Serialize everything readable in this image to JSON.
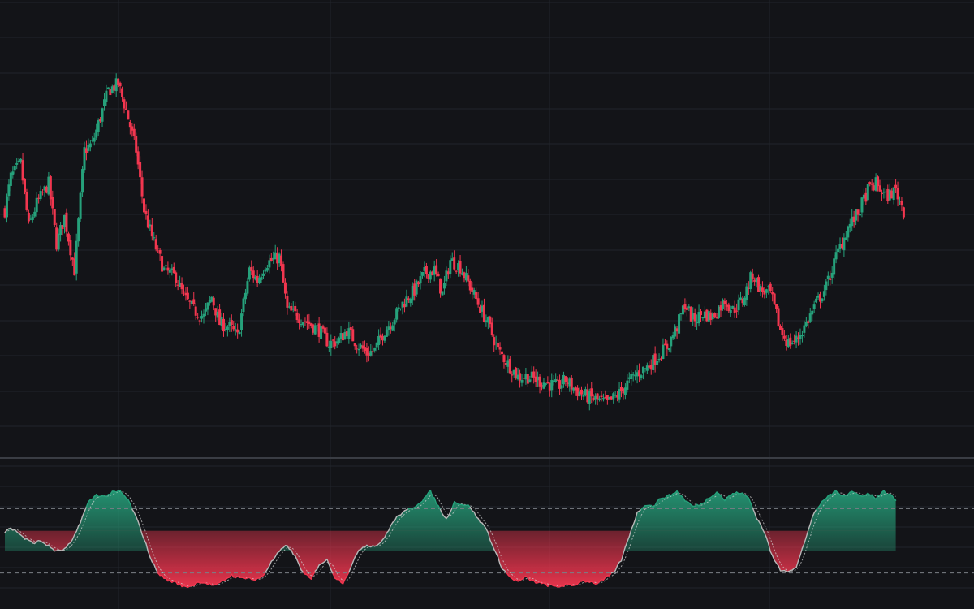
{
  "theme": {
    "background": "#131418",
    "grid_color": "#22252b",
    "separator_color": "#3a3d44",
    "up_color": "#26a17b",
    "down_color": "#f2364f",
    "oscillator_line_color": "#b7b7b7",
    "level_line_color": "#7c7f86"
  },
  "chart_data": [
    {
      "type": "candlestick",
      "pane": "price",
      "grid": true,
      "ylim": [
        0,
        100
      ],
      "anchors_close": [
        [
          0,
          60
        ],
        [
          3,
          70
        ],
        [
          8,
          74
        ],
        [
          12,
          55
        ],
        [
          16,
          62
        ],
        [
          22,
          68
        ],
        [
          26,
          50
        ],
        [
          30,
          58
        ],
        [
          35,
          42
        ],
        [
          40,
          78
        ],
        [
          44,
          80
        ],
        [
          48,
          88
        ],
        [
          52,
          96
        ],
        [
          57,
          98
        ],
        [
          61,
          90
        ],
        [
          66,
          78
        ],
        [
          70,
          60
        ],
        [
          74,
          52
        ],
        [
          80,
          42
        ],
        [
          86,
          40
        ],
        [
          90,
          34
        ],
        [
          95,
          30
        ],
        [
          100,
          28
        ],
        [
          104,
          34
        ],
        [
          108,
          26
        ],
        [
          113,
          25
        ],
        [
          117,
          22
        ],
        [
          123,
          42
        ],
        [
          127,
          39
        ],
        [
          131,
          44
        ],
        [
          138,
          46
        ],
        [
          142,
          30
        ],
        [
          148,
          28
        ],
        [
          153,
          26
        ],
        [
          158,
          24
        ],
        [
          163,
          20
        ],
        [
          168,
          21
        ],
        [
          172,
          24
        ],
        [
          177,
          20
        ],
        [
          182,
          17
        ],
        [
          186,
          18
        ],
        [
          191,
          24
        ],
        [
          195,
          27
        ],
        [
          200,
          32
        ],
        [
          206,
          36
        ],
        [
          211,
          41
        ],
        [
          216,
          42
        ],
        [
          220,
          35
        ],
        [
          224,
          45
        ],
        [
          229,
          43
        ],
        [
          234,
          37
        ],
        [
          238,
          32
        ],
        [
          243,
          26
        ],
        [
          248,
          18
        ],
        [
          253,
          14
        ],
        [
          258,
          10
        ],
        [
          263,
          10
        ],
        [
          268,
          9
        ],
        [
          273,
          8
        ],
        [
          278,
          7
        ],
        [
          282,
          9
        ],
        [
          287,
          6
        ],
        [
          293,
          4
        ],
        [
          298,
          3
        ],
        [
          303,
          2
        ],
        [
          309,
          5
        ],
        [
          313,
          8
        ],
        [
          318,
          11
        ],
        [
          323,
          13
        ],
        [
          328,
          16
        ],
        [
          333,
          19
        ],
        [
          338,
          25
        ],
        [
          342,
          32
        ],
        [
          346,
          27
        ],
        [
          351,
          29
        ],
        [
          356,
          28
        ],
        [
          362,
          33
        ],
        [
          366,
          30
        ],
        [
          371,
          33
        ],
        [
          376,
          41
        ],
        [
          380,
          36
        ],
        [
          385,
          35
        ],
        [
          390,
          24
        ],
        [
          394,
          20
        ],
        [
          398,
          21
        ],
        [
          403,
          26
        ],
        [
          408,
          32
        ],
        [
          413,
          37
        ],
        [
          418,
          46
        ],
        [
          424,
          55
        ],
        [
          429,
          59
        ],
        [
          434,
          66
        ],
        [
          438,
          68
        ],
        [
          443,
          64
        ],
        [
          448,
          66
        ],
        [
          452,
          60
        ]
      ]
    },
    {
      "type": "area",
      "pane": "oscillator",
      "grid": true,
      "ylim": [
        0,
        100
      ],
      "levels": [
        80,
        20
      ],
      "anchors": [
        [
          0,
          58
        ],
        [
          2,
          62
        ],
        [
          6,
          59
        ],
        [
          10,
          52
        ],
        [
          14,
          48
        ],
        [
          18,
          50
        ],
        [
          22,
          45
        ],
        [
          26,
          40
        ],
        [
          30,
          42
        ],
        [
          34,
          50
        ],
        [
          38,
          68
        ],
        [
          42,
          86
        ],
        [
          46,
          93
        ],
        [
          50,
          91
        ],
        [
          54,
          95
        ],
        [
          58,
          96
        ],
        [
          62,
          88
        ],
        [
          66,
          72
        ],
        [
          70,
          52
        ],
        [
          74,
          30
        ],
        [
          78,
          18
        ],
        [
          82,
          13
        ],
        [
          86,
          11
        ],
        [
          90,
          7
        ],
        [
          94,
          8
        ],
        [
          98,
          12
        ],
        [
          102,
          10
        ],
        [
          106,
          8
        ],
        [
          110,
          13
        ],
        [
          114,
          18
        ],
        [
          118,
          15
        ],
        [
          122,
          16
        ],
        [
          126,
          13
        ],
        [
          130,
          18
        ],
        [
          134,
          30
        ],
        [
          138,
          40
        ],
        [
          142,
          46
        ],
        [
          146,
          35
        ],
        [
          150,
          20
        ],
        [
          154,
          14
        ],
        [
          158,
          28
        ],
        [
          162,
          32
        ],
        [
          166,
          16
        ],
        [
          170,
          11
        ],
        [
          174,
          25
        ],
        [
          178,
          42
        ],
        [
          182,
          46
        ],
        [
          186,
          45
        ],
        [
          190,
          50
        ],
        [
          194,
          64
        ],
        [
          198,
          74
        ],
        [
          202,
          78
        ],
        [
          206,
          82
        ],
        [
          210,
          88
        ],
        [
          214,
          96
        ],
        [
          218,
          82
        ],
        [
          222,
          70
        ],
        [
          226,
          86
        ],
        [
          230,
          84
        ],
        [
          234,
          82
        ],
        [
          238,
          70
        ],
        [
          242,
          62
        ],
        [
          246,
          42
        ],
        [
          250,
          25
        ],
        [
          254,
          16
        ],
        [
          258,
          12
        ],
        [
          262,
          16
        ],
        [
          266,
          12
        ],
        [
          270,
          10
        ],
        [
          274,
          8
        ],
        [
          278,
          7
        ],
        [
          282,
          9
        ],
        [
          286,
          8
        ],
        [
          290,
          13
        ],
        [
          294,
          12
        ],
        [
          298,
          10
        ],
        [
          302,
          15
        ],
        [
          306,
          20
        ],
        [
          310,
          32
        ],
        [
          314,
          55
        ],
        [
          318,
          76
        ],
        [
          322,
          84
        ],
        [
          326,
          82
        ],
        [
          330,
          90
        ],
        [
          334,
          92
        ],
        [
          338,
          96
        ],
        [
          342,
          88
        ],
        [
          346,
          82
        ],
        [
          350,
          84
        ],
        [
          354,
          90
        ],
        [
          358,
          96
        ],
        [
          362,
          88
        ],
        [
          366,
          94
        ],
        [
          370,
          95
        ],
        [
          374,
          90
        ],
        [
          378,
          72
        ],
        [
          382,
          58
        ],
        [
          386,
          35
        ],
        [
          390,
          23
        ],
        [
          394,
          22
        ],
        [
          398,
          25
        ],
        [
          402,
          48
        ],
        [
          406,
          72
        ],
        [
          410,
          84
        ],
        [
          414,
          92
        ],
        [
          418,
          96
        ],
        [
          422,
          92
        ],
        [
          426,
          96
        ],
        [
          430,
          92
        ],
        [
          434,
          94
        ],
        [
          438,
          90
        ],
        [
          442,
          96
        ],
        [
          446,
          92
        ],
        [
          448,
          88
        ]
      ]
    }
  ]
}
